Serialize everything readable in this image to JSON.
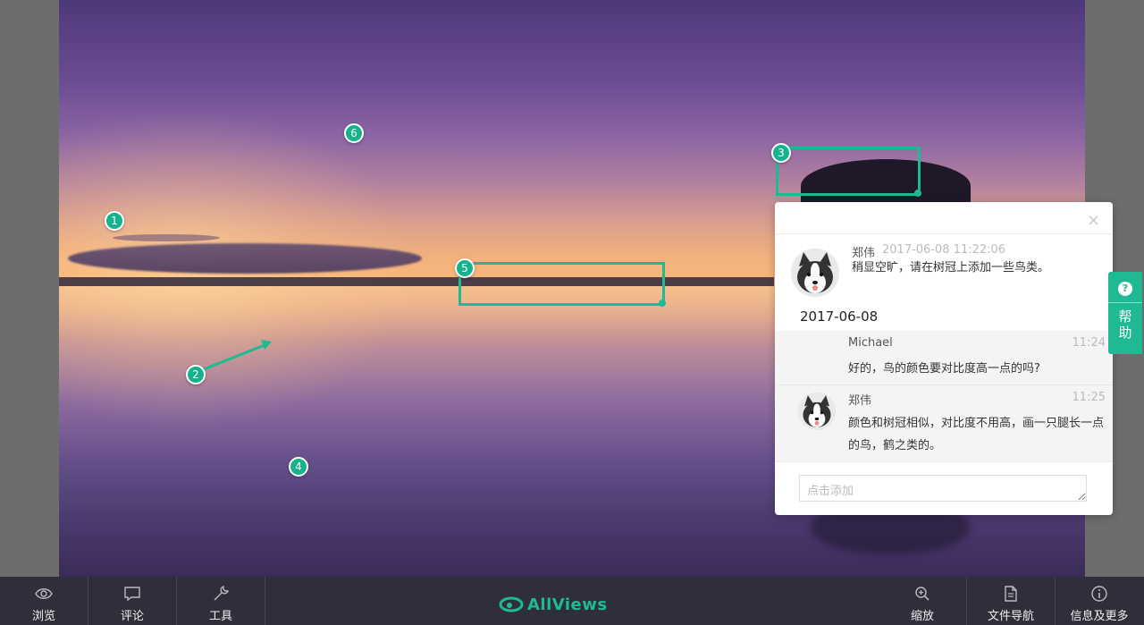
{
  "annotations": {
    "markers": [
      "1",
      "2",
      "3",
      "4",
      "5",
      "6"
    ]
  },
  "comment_panel": {
    "close": "×",
    "original": {
      "author": "郑伟",
      "time": "2017-06-08 11:22:06",
      "text": "稍显空旷，请在树冠上添加一些鸟类。"
    },
    "date_separator": "2017-06-08",
    "replies": [
      {
        "author": "Michael",
        "time": "11:24",
        "text": "好的，鸟的颜色要对比度高一点的吗?"
      },
      {
        "author": "郑伟",
        "time": "11:25",
        "text": "颜色和树冠相似，对比度不用高，画一只腿长一点的鸟，鹤之类的。"
      }
    ],
    "input_placeholder": "点击添加"
  },
  "help_tab": {
    "icon": "question-icon",
    "label": "帮助"
  },
  "toolbar": {
    "left": [
      {
        "label": "浏览",
        "icon": "eye-icon"
      },
      {
        "label": "评论",
        "icon": "comment-icon"
      },
      {
        "label": "工具",
        "icon": "wrench-icon"
      }
    ],
    "logo_text": "AllViews",
    "right": [
      {
        "label": "缩放",
        "icon": "zoom-in-icon"
      },
      {
        "label": "文件导航",
        "icon": "document-icon"
      },
      {
        "label": "信息及更多",
        "icon": "info-icon"
      }
    ]
  },
  "colors": {
    "accent": "#1fb993",
    "toolbar_bg": "#2f2f3c",
    "page_bg": "#6d6d6d"
  }
}
